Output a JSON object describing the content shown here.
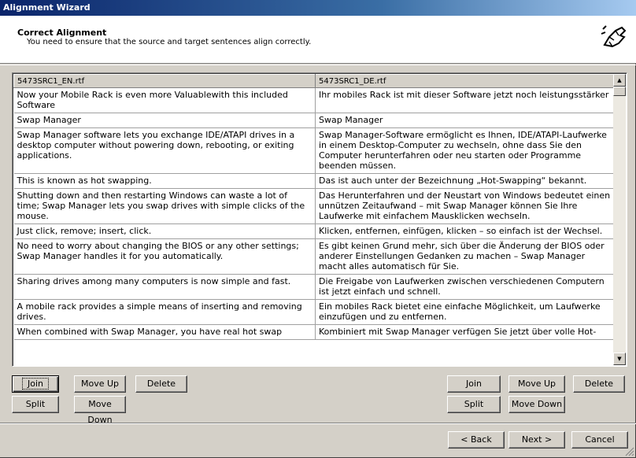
{
  "window": {
    "title": "Alignment Wizard"
  },
  "header": {
    "title": "Correct Alignment",
    "subtitle": "You need to ensure that the source and target sentences align correctly.",
    "icon": "wizard-hand-icon"
  },
  "grid": {
    "source_header": "5473SRC1_EN.rtf",
    "target_header": "5473SRC1_DE.rtf",
    "rows": [
      {
        "source": "Now your Mobile Rack is even more Valuablewith this included Software",
        "target": "Ihr mobiles Rack ist mit dieser Software jetzt noch leistungsstärker"
      },
      {
        "source": "Swap Manager",
        "target": "Swap Manager"
      },
      {
        "source": "Swap Manager software lets you exchange IDE/ATAPI drives in a desktop computer without powering down, rebooting, or exiting applications.",
        "target": "Swap Manager-Software ermöglicht es Ihnen, IDE/ATAPI-Laufwerke in einem Desktop-Computer zu wechseln, ohne dass Sie den Computer herunterfahren oder neu starten oder Programme beenden müssen."
      },
      {
        "source": "This is known as hot swapping.",
        "target": "Das ist auch unter der Bezeichnung „Hot-Swapping“ bekannt."
      },
      {
        "source": "Shutting down and then restarting Windows can waste a lot of time; Swap Manager lets you swap drives with simple clicks of the mouse.",
        "target": "Das Herunterfahren und der Neustart von Windows bedeutet einen unnützen Zeitaufwand – mit Swap Manager können Sie Ihre Laufwerke mit einfachem Mausklicken wechseln."
      },
      {
        "source": "Just click, remove; insert, click.",
        "target": "Klicken, entfernen, einfügen, klicken – so einfach ist der Wechsel."
      },
      {
        "source": "No need to worry about changing the BIOS or any other settings; Swap Manager handles it for you automatically.",
        "target": "Es gibt keinen Grund mehr, sich über die Änderung der BIOS oder anderer Einstellungen Gedanken zu machen – Swap Manager macht alles automatisch für Sie."
      },
      {
        "source": "Sharing drives among many computers is now simple and fast.",
        "target": "Die Freigabe von Laufwerken zwischen verschiedenen Computern ist jetzt einfach und schnell."
      },
      {
        "source": "A mobile rack provides a simple means of inserting and removing drives.",
        "target": "Ein mobiles Rack bietet eine einfache Möglichkeit, um Laufwerke einzufügen und zu entfernen."
      },
      {
        "source": "When combined with Swap Manager, you have real hot swap",
        "target": "Kombiniert mit Swap Manager verfügen Sie jetzt über volle Hot-"
      }
    ]
  },
  "left_buttons": {
    "join": "Join",
    "move_up": "Move Up",
    "delete": "Delete",
    "split": "Split",
    "move_down": "Move Down"
  },
  "right_buttons": {
    "join": "Join",
    "move_up": "Move Up",
    "delete": "Delete",
    "split": "Split",
    "move_down": "Move Down"
  },
  "footer": {
    "back": "< Back",
    "next": "Next >",
    "cancel": "Cancel"
  }
}
